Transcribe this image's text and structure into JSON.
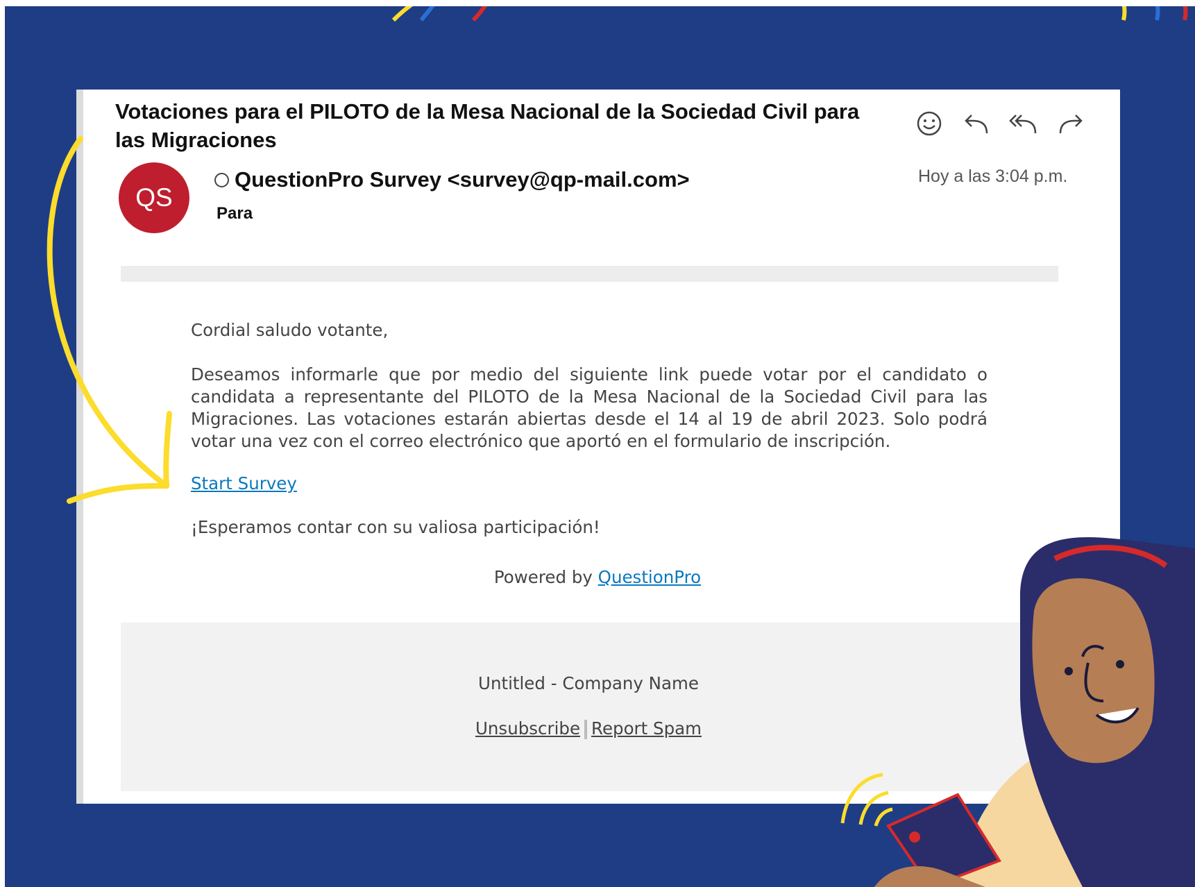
{
  "email": {
    "subject": "Votaciones para el PILOTO de la Mesa Nacional de la Sociedad Civil para las Migraciones",
    "avatar_initials": "QS",
    "sender": "QuestionPro Survey <survey@qp-mail.com>",
    "to_label": "Para",
    "received": "Hoy a las 3:04 p.m.",
    "actions": [
      {
        "icon": "smiley-icon"
      },
      {
        "icon": "reply-icon"
      },
      {
        "icon": "reply-all-icon"
      },
      {
        "icon": "forward-icon"
      }
    ]
  },
  "body": {
    "greeting": "Cordial saludo votante,",
    "paragraph": "Deseamos informarle que por medio del siguiente link puede votar por el candidato o candidata a representante del PILOTO de la Mesa Nacional de la Sociedad Civil para las Migraciones. Las votaciones estarán abiertas desde el 14 al 19 de abril 2023. Solo podrá votar una vez con el correo electrónico que aportó en el formulario de inscripción.",
    "link_text": "Start Survey ",
    "closing": "¡Esperamos contar con su valiosa participación!",
    "powered_prefix": "Powered by",
    "powered_link": "QuestionPro"
  },
  "footer": {
    "company": "Untitled - Company Name",
    "unsubscribe": "Unsubscribe",
    "report_spam": "Report Spam"
  },
  "colors": {
    "background": "#1e3d85",
    "avatar": "#bf1e2e",
    "link": "#0b78be",
    "accent_yellow": "#fcdc2c"
  }
}
